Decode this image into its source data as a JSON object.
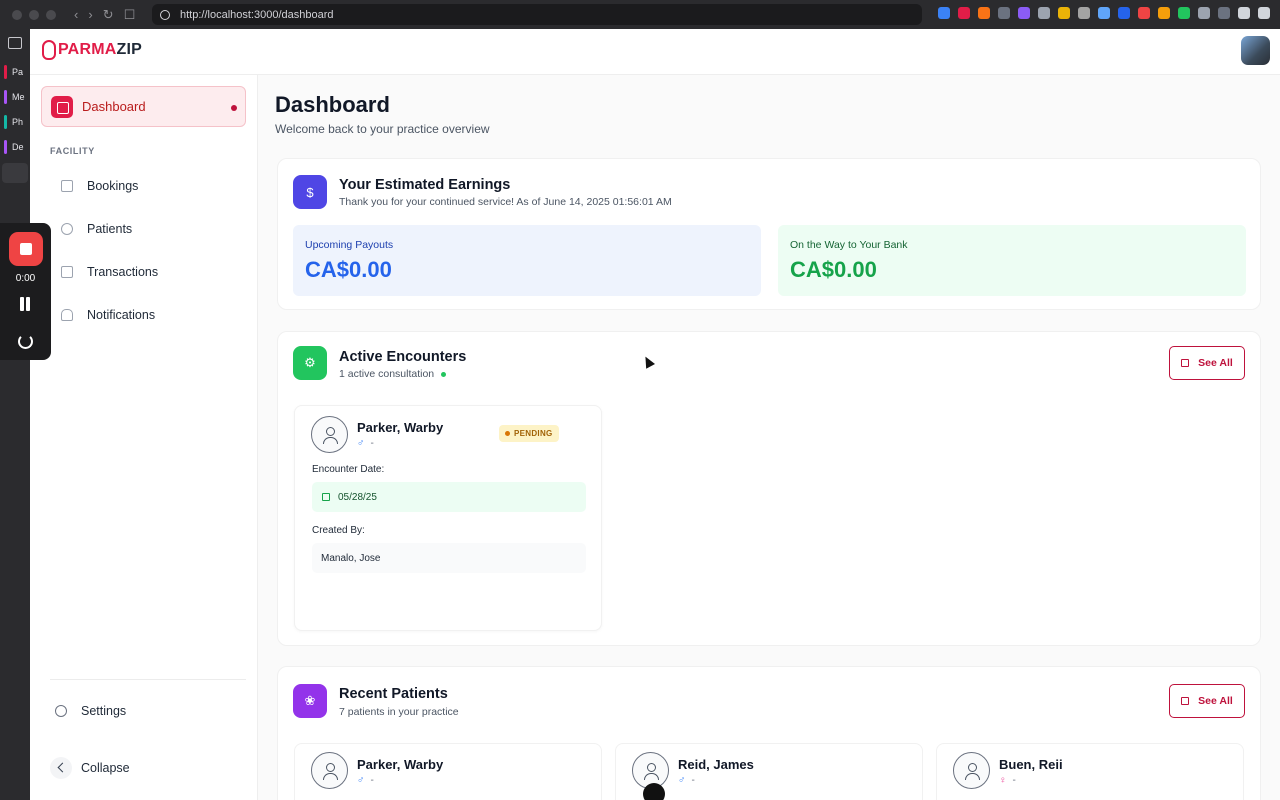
{
  "browser": {
    "url": "http://localhost:3000/dashboard",
    "sidebar_tabs": [
      "Pa",
      "Me",
      "Ph",
      "De"
    ]
  },
  "recorder": {
    "time": "0:00"
  },
  "app": {
    "logo_part1": "PARMA",
    "logo_part2": "ZIP"
  },
  "sidebar": {
    "active_item": "Dashboard",
    "section_label": "FACILITY",
    "items": [
      {
        "label": "Bookings",
        "icon": "calendar-icon"
      },
      {
        "label": "Patients",
        "icon": "user-icon"
      },
      {
        "label": "Transactions",
        "icon": "document-icon"
      },
      {
        "label": "Notifications",
        "icon": "bell-icon"
      }
    ],
    "settings_label": "Settings",
    "collapse_label": "Collapse"
  },
  "header": {
    "title": "Dashboard",
    "subtitle": "Welcome back to your practice overview"
  },
  "earnings": {
    "icon_glyph": "$",
    "title": "Your Estimated Earnings",
    "subtitle": "Thank you for your continued service! As of June 14, 2025 01:56:01 AM",
    "upcoming_label": "Upcoming Payouts",
    "upcoming_value": "CA$0.00",
    "bank_label": "On the Way to Your Bank",
    "bank_value": "CA$0.00"
  },
  "encounters": {
    "title": "Active Encounters",
    "subtitle": "1 active consultation",
    "see_all": "See All",
    "items": [
      {
        "name": "Parker, Warby",
        "gender_symbol": "♂",
        "age": "-",
        "status": "PENDING",
        "date_label": "Encounter Date:",
        "date": "05/28/25",
        "created_by_label": "Created By:",
        "created_by": "Manalo, Jose"
      }
    ]
  },
  "recent_patients": {
    "title": "Recent Patients",
    "subtitle": "7 patients in your practice",
    "see_all": "See All",
    "items": [
      {
        "name": "Parker, Warby",
        "gender_symbol": "♂",
        "age": "-"
      },
      {
        "name": "Reid, James",
        "gender_symbol": "♂",
        "age": "-"
      },
      {
        "name": "Buen, Reii",
        "gender_symbol": "♀",
        "age": "-"
      }
    ]
  },
  "colors": {
    "brand": "#e11d48",
    "earnings_icon": "#4f46e5",
    "encounters_icon": "#22c55e",
    "patients_icon": "#9333ea",
    "upcoming_value": "#2563eb",
    "bank_value": "#16a34a"
  }
}
